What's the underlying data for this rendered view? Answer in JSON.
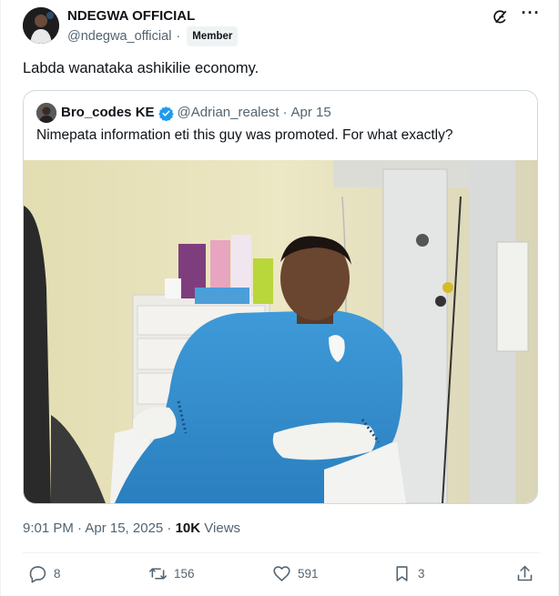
{
  "author": {
    "display_name": "NDEGWA OFFICIAL",
    "handle": "@ndegwa_official",
    "separator": "·",
    "badge": "Member"
  },
  "tweet": {
    "text": "Labda wanataka ashikilie economy."
  },
  "quote": {
    "name": "Bro_codes KE",
    "handle": "@Adrian_realest",
    "separator": "·",
    "date": "Apr 15",
    "text": "Nimepata information eti this guy was promoted. For what exactly?"
  },
  "meta": {
    "timestamp": "9:01 PM · Apr 15, 2025 · ",
    "views_count": "10K",
    "views_label": " Views"
  },
  "actions": {
    "replies": "8",
    "reposts": "156",
    "likes": "591",
    "bookmarks": "3"
  },
  "icons": {
    "grok": "grok-icon",
    "more": "more-icon",
    "reply": "reply-icon",
    "repost": "repost-icon",
    "like": "like-icon",
    "bookmark": "bookmark-icon",
    "share": "share-icon",
    "verified": "verified-badge-icon"
  },
  "colors": {
    "text": "#0f1419",
    "secondary": "#536471",
    "border": "#cfd9de",
    "verified": "#1d9bf0"
  }
}
